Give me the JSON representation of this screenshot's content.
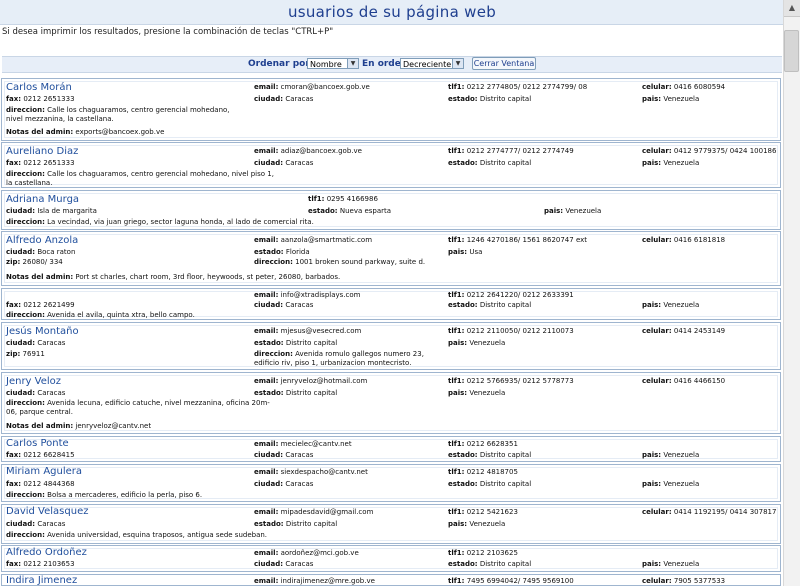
{
  "header": {
    "title": "usuarios de su página web"
  },
  "print_note": "Si desea imprimir los resultados, presione la combinación de teclas \"CTRL+P\"",
  "controls": {
    "order_by_label": "Ordenar por:",
    "order_by_value": "Nombre",
    "order_label": "En orden",
    "order_value": "Decreciente",
    "close_button": "Cerrar Ventana"
  },
  "labels": {
    "email": "email:",
    "tlf1": "tlf1:",
    "celular": "celular:",
    "fax": "fax:",
    "ciudad": "ciudad:",
    "estado": "estado:",
    "pais": "pais:",
    "direccion": "direccion:",
    "zip": "zip:",
    "notas": "Notas del admin:"
  },
  "users": [
    {
      "name": "Carlos Morán",
      "email": "cmoran@bancoex.gob.ve",
      "tlf1": "0212 2774805/ 0212 2774799/ 08",
      "celular": "0416 6080594",
      "fax": "0212 2651333",
      "ciudad": "Caracas",
      "estado": "Distrito capital",
      "pais": "Venezuela",
      "direccion": "Calle los chaguaramos, centro gerencial mohedano, nivel mezzanina, la castellana.",
      "notas": "exports@bancoex.gob.ve"
    },
    {
      "name": "Aureliano Diaz",
      "email": "adiaz@bancoex.gob.ve",
      "tlf1": "0212 2774777/ 0212 2774749",
      "celular": "0412 9779375/ 0424 100186",
      "fax": "0212 2651333",
      "ciudad": "Caracas",
      "estado": "Distrito capital",
      "pais": "Venezuela",
      "direccion": "Calle los chaguaramos, centro gerencial mohedano, nivel piso 1, la castellana."
    },
    {
      "name": "Adriana Murga",
      "tlf1": "0295 4166986",
      "ciudad": "Isla de margarita",
      "estado": "Nueva esparta",
      "pais": "Venezuela",
      "direccion": "La vecindad, via juan griego, sector laguna honda, al lado de comercial rita."
    },
    {
      "name": "Alfredo Anzola",
      "email": "aanzola@smartmatic.com",
      "tlf1": "1246 4270186/ 1561 8620747 ext",
      "celular": "0416 6181818",
      "ciudad": "Boca raton",
      "estado": "Florida",
      "pais": "Usa",
      "zip": "26080/ 334",
      "direccion": "1001 broken sound parkway, suite d.",
      "notas": "Port st charles, chart room, 3rd floor, heywoods, st peter, 26080, barbados."
    },
    {
      "name": "",
      "email": "info@xtradisplays.com",
      "tlf1": "0212 2641220/ 0212 2633391",
      "fax": "0212 2621499",
      "ciudad": "Caracas",
      "estado": "Distrito capital",
      "pais": "Venezuela",
      "direccion": "Avenida el avila, quinta xtra, bello campo."
    },
    {
      "name": "Jesús Montaño",
      "email": "mjesus@vesecred.com",
      "tlf1": "0212 2110050/ 0212 2110073",
      "celular": "0414 2453149",
      "ciudad": "Caracas",
      "estado": "Distrito capital",
      "pais": "Venezuela",
      "zip": "76911",
      "direccion": "Avenida romulo gallegos numero 23, edificio riv, piso 1, urbanizacion montecristo."
    },
    {
      "name": "Jenry Veloz",
      "email": "jenryveloz@hotmail.com",
      "tlf1": "0212 5766935/ 0212 5778773",
      "celular": "0416 4466150",
      "ciudad": "Caracas",
      "estado": "Distrito capital",
      "pais": "Venezuela",
      "direccion": "Avenida lecuna, edificio catuche, nivel mezzanina, oficina 20m-06, parque central.",
      "notas": "jenryveloz@cantv.net"
    },
    {
      "name": "Carlos Ponte",
      "email": "mecielec@cantv.net",
      "tlf1": "0212 6628351",
      "fax": "0212 6628415",
      "ciudad": "Caracas",
      "estado": "Distrito capital",
      "pais": "Venezuela"
    },
    {
      "name": "Miriam Agulera",
      "email": "siexdespacho@cantv.net",
      "tlf1": "0212 4818705",
      "fax": "0212 4844368",
      "ciudad": "Caracas",
      "estado": "Distrito capital",
      "pais": "Venezuela",
      "direccion": "Bolsa a mercaderes, edificio la perla, piso 6."
    },
    {
      "name": "David Velasquez",
      "email": "mipadesdavid@gmail.com",
      "tlf1": "0212 5421623",
      "celular": "0414 1192195/ 0414 307817",
      "ciudad": "Caracas",
      "estado": "Distrito capital",
      "pais": "Venezuela",
      "direccion": "Avenida universidad, esquina traposos, antigua sede sudeban."
    },
    {
      "name": "Alfredo Ordoñez",
      "email": "aordoñez@mci.gob.ve",
      "tlf1": "0212 2103625",
      "fax": "0212 2103653",
      "ciudad": "Caracas",
      "estado": "Distrito capital",
      "pais": "Venezuela"
    },
    {
      "name": "Indira Jimenez",
      "email": "indirajimenez@mre.gob.ve",
      "tlf1": "7495 6994042/ 7495 9569100",
      "celular": "7905 5377533"
    }
  ]
}
